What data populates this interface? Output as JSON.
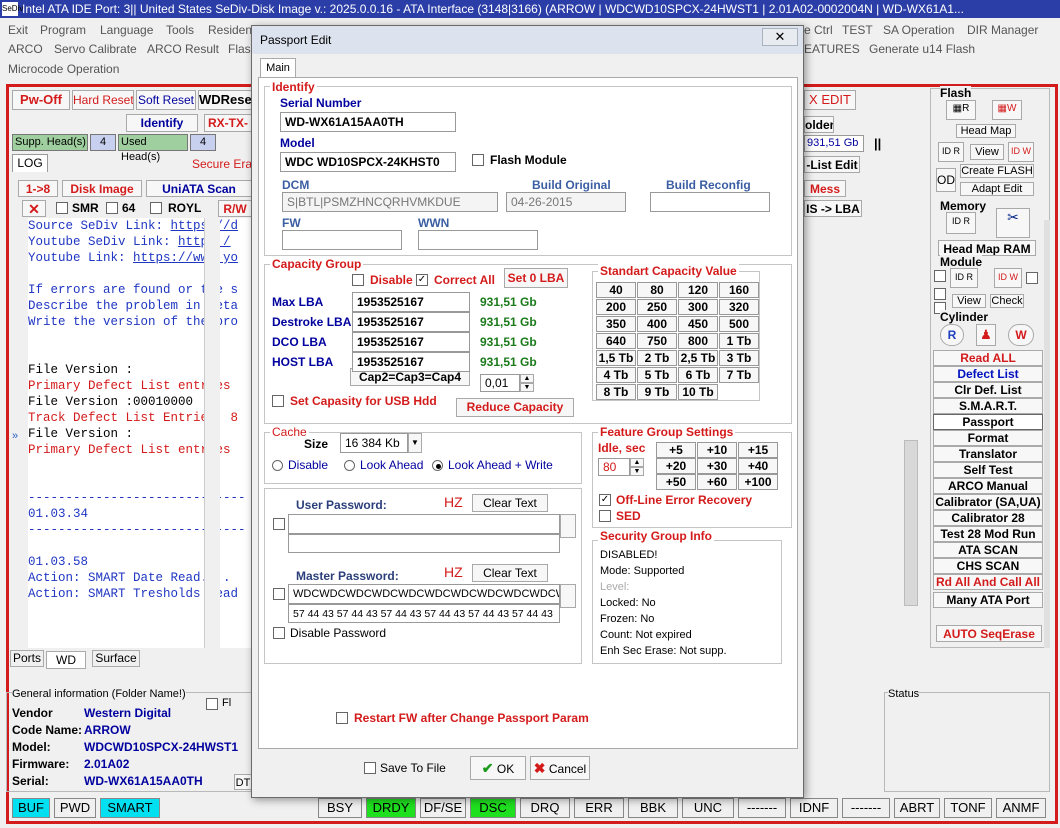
{
  "titlebar": {
    "logo": "SeDiv",
    "text": "Intel ATA IDE  Port: 3|| United States  SeDiv-Disk Image v.: 2025.0.0.16 - ATA Interface (3148|3166)  (ARROW | WDCWD10SPCX-24HWST1 | 2.01A02-0002004N | WD-WX61A1..."
  },
  "menu": {
    "row1": [
      "Exit",
      "Program",
      "Language",
      "Tools",
      "Residen",
      "e Ctrl",
      "SA Operation",
      "DIR Manager"
    ],
    "row1_test": "TEST",
    "row2": [
      "ARCO",
      "Servo Calibrate",
      "ARCO Result",
      "Flash",
      "EATURES",
      "Generate u14 Flash"
    ],
    "row3": [
      "Microcode Operation"
    ]
  },
  "toolbar": {
    "pw_off": "Pw-Off",
    "hard_reset": "Hard Reset",
    "soft_reset": "Soft Reset",
    "wdreset": "WDReset",
    "identify": "Identify",
    "rx_tx": "RX-TX-",
    "supp_heads_label": "Supp. Head(s)",
    "supp_heads_val": "4",
    "used_heads_label": "Used Head(s)",
    "used_heads_val": "4",
    "log_tab": "LOG",
    "secure_erase": "Secure Erase",
    "one_to_8": "1->8",
    "disk_image": "Disk Image",
    "uniata_scan": "UniATA Scan",
    "smr": "SMR",
    "sixty_four": "64",
    "royl": "ROYL",
    "rw": "R/W",
    "x_edit": "X EDIT",
    "folder": "older",
    "capacity": "931,51 Gb",
    "list_edit": "-List Edit",
    "mess": "Mess",
    "is_lba": "IS -> LBA"
  },
  "log": {
    "lines": [
      {
        "t": "Source SeDiv Link: ",
        "l": "https://d",
        "c": "blue"
      },
      {
        "t": "Youtube SeDiv Link: ",
        "l": "https:/",
        "c": "blue"
      },
      {
        "t": "Youtube Link: ",
        "l": "https://www.yo",
        "c": "blue"
      },
      {
        "t": "",
        "c": "blue"
      },
      {
        "t": "If errors are found or the s",
        "c": "blue"
      },
      {
        "t": "Describe the problem in deta",
        "c": "blue"
      },
      {
        "t": "Write the version of the pro",
        "c": "blue"
      },
      {
        "t": "",
        "c": "blue"
      },
      {
        "t": "",
        "c": "blue"
      },
      {
        "t": "File Version :",
        "c": "black"
      },
      {
        "t": "Primary Defect List entries",
        "c": "red"
      },
      {
        "t": "File Version :00010000",
        "c": "black"
      },
      {
        "t": "Track Defect List Entries: 8",
        "c": "red"
      },
      {
        "t": "File Version :",
        "c": "black"
      },
      {
        "t": "Primary Defect List entries",
        "c": "red"
      },
      {
        "t": "",
        "c": "blue"
      },
      {
        "t": "",
        "c": "blue"
      },
      {
        "t": "-----------------------------",
        "c": "blue"
      },
      {
        "t": "01.03.34",
        "c": "blue"
      },
      {
        "t": "-----------------------------",
        "c": "blue"
      },
      {
        "t": "",
        "c": "blue"
      },
      {
        "t": "01.03.58",
        "c": "blue"
      },
      {
        "t": "Action: SMART Date Read....",
        "c": "blue"
      },
      {
        "t": "Action: SMART Tresholds Read",
        "c": "blue"
      }
    ]
  },
  "bottom_tabs": [
    "Ports",
    "WD",
    "Surface"
  ],
  "general": {
    "title": "General information (Folder Name!)",
    "fl": "Fl",
    "rows": [
      {
        "k": "Vendor",
        "v": "Western Digital"
      },
      {
        "k": "Code Name:",
        "v": "ARROW"
      },
      {
        "k": "Model:",
        "v": "WDCWD10SPCX-24HWST1"
      },
      {
        "k": "Firmware:",
        "v": "2.01A02"
      },
      {
        "k": "Serial:",
        "v": "WD-WX61A15AA0TH"
      }
    ],
    "dt": "DT"
  },
  "status_label": "Status",
  "right_panel": {
    "flash": "Flash",
    "head_map": "Head Map",
    "view": "View",
    "create_flash": "Create FLASH",
    "od": "OD",
    "adapt_edit": "Adapt Edit",
    "memory": "Memory",
    "head_map_ram": "Head Map RAM",
    "module": "Module",
    "view2": "View",
    "check": "Check",
    "cylinder": "Cylinder",
    "buttons": [
      "Read ALL",
      "Defect List",
      "Clr Def. List",
      "S.M.A.R.T.",
      "Passport",
      "Format",
      "Translator",
      "Self Test",
      "ARCO Manual",
      "Calibrator (SA,UA)",
      "Calibrator 28",
      "Test 28 Mod Run",
      "ATA SCAN",
      "CHS SCAN",
      "Rd All And Call All",
      "Many ATA Port"
    ],
    "auto_seq": "AUTO SeqErase"
  },
  "statusbar": {
    "left": [
      "BUF",
      "PWD",
      "SMART"
    ],
    "right": [
      "BSY",
      "DRDY",
      "DF/SE",
      "DSC",
      "DRQ",
      "ERR",
      "BBK",
      "UNC",
      "-------",
      "IDNF",
      "-------",
      "ABRT",
      "TONF",
      "ANMF"
    ]
  },
  "dialog": {
    "title": "Passport Edit",
    "close": "✕",
    "tab": "Main",
    "identify": {
      "group": "Identify",
      "serial_label": "Serial Number",
      "serial": "WD-WX61A15AA0TH",
      "model_label": "Model",
      "model": "WDC WD10SPCX-24KHST0",
      "flash_module": "Flash Module",
      "dcm_label": "DCM",
      "dcm": "S|BTL|PSMZHNCQRHVMKDUE",
      "build_orig_label": "Build Original",
      "build_orig": "04-26-2015",
      "build_reconf_label": "Build Reconfig",
      "build_reconf": "",
      "fw_label": "FW",
      "fw": "",
      "wwn_label": "WWN",
      "wwn": ""
    },
    "capacity": {
      "group": "Capacity Group",
      "disable": "Disable",
      "correct_all": "Correct All",
      "set0": "Set 0 LBA",
      "rows": [
        {
          "k": "Max LBA",
          "v": "1953525167",
          "gb": "931,51 Gb"
        },
        {
          "k": "Destroke LBA",
          "v": "1953525167",
          "gb": "931,51 Gb"
        },
        {
          "k": "DCO LBA",
          "v": "1953525167",
          "gb": "931,51 Gb"
        },
        {
          "k": "HOST LBA",
          "v": "1953525167",
          "gb": "931,51 Gb"
        }
      ],
      "cap_eq": "Cap2=Cap3=Cap4",
      "step": "0,01",
      "usb": "Set Capasity for USB Hdd",
      "reduce": "Reduce Capacity",
      "std_title": "Standart Capacity Value",
      "std": [
        "40",
        "80",
        "120",
        "160",
        "200",
        "250",
        "300",
        "320",
        "350",
        "400",
        "450",
        "500",
        "640",
        "750",
        "800",
        "1 Tb",
        "1,5 Tb",
        "2 Tb",
        "2,5 Tb",
        "3 Tb",
        "4 Tb",
        "5 Tb",
        "6 Tb",
        "7 Tb",
        "8 Tb",
        "9 Tb",
        "10 Tb"
      ]
    },
    "cache": {
      "group": "Cache",
      "size_label": "Size",
      "size": "16 384 Kb",
      "disable": "Disable",
      "look_ahead": "Look Ahead",
      "look_ahead_write": "Look Ahead + Write"
    },
    "feature": {
      "group": "Feature Group Settings",
      "idle_label": "Idle, sec",
      "idle": "80",
      "buttons": [
        "+5",
        "+10",
        "+15",
        "+20",
        "+30",
        "+40",
        "+50",
        "+60",
        "+100"
      ],
      "offline": "Off-Line Error Recovery",
      "sed": "SED"
    },
    "password": {
      "user_label": "User Password:",
      "hz1": "HZ",
      "clear1": "Clear Text",
      "user_val": "",
      "user_hex": "",
      "master_label": "Master Password:",
      "hz2": "HZ",
      "clear2": "Clear Text",
      "master_val": "WDCWDCWDCWDCWDCWDCWDCWDCWDCWDCW",
      "master_hex": "57 44 43 57 44 43 57 44 43 57 44 43 57 44 43 57 44 43",
      "disable_pwd": "Disable Password"
    },
    "security": {
      "group": "Security Group Info",
      "lines": [
        "DISABLED!",
        "Mode: Supported",
        "Level:",
        "Locked: No",
        "Frozen: No",
        "Count: Not expired",
        "Enh Sec Erase: Not supp."
      ]
    },
    "restart": "Restart FW after Change Passport Param",
    "save_to_file": "Save To File",
    "ok": "OK",
    "cancel": "Cancel"
  }
}
